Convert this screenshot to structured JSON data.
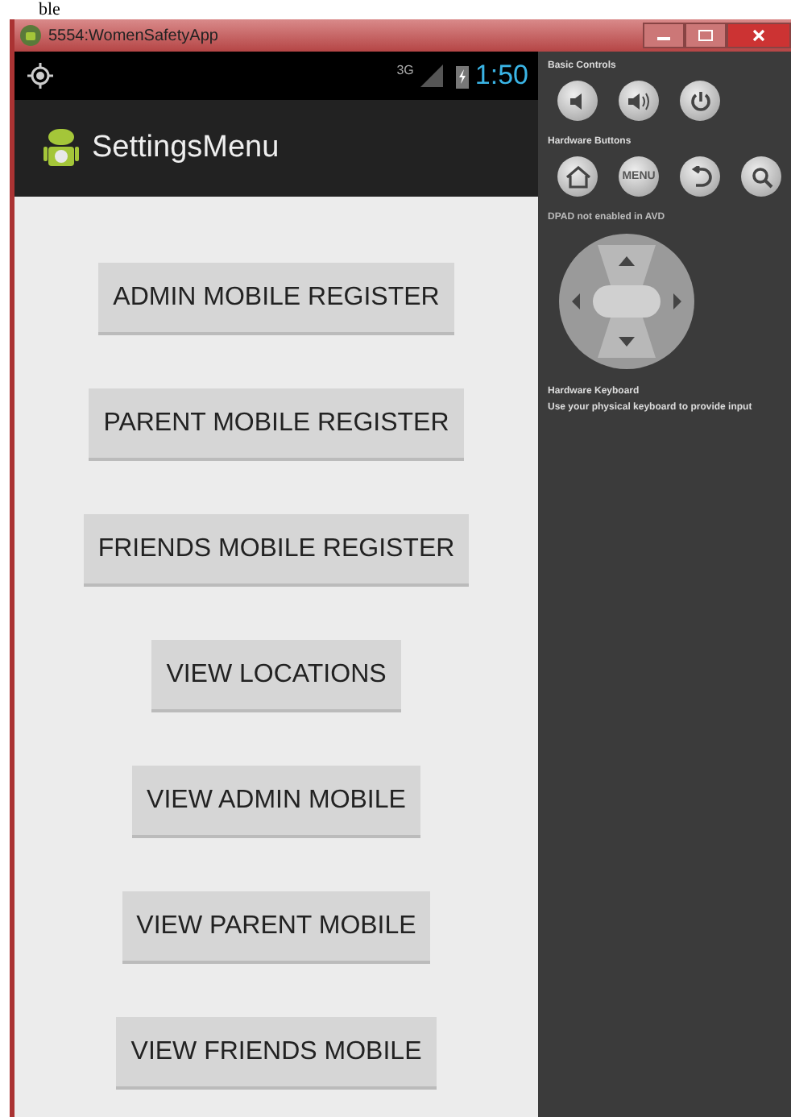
{
  "page_fragment": "ble",
  "window": {
    "title": "5554:WomenSafetyApp"
  },
  "status_bar": {
    "network": "3G",
    "time": "1:50"
  },
  "action_bar": {
    "title": "SettingsMenu"
  },
  "buttons": [
    "ADMIN MOBILE REGISTER",
    "PARENT MOBILE REGISTER",
    "FRIENDS MOBILE REGISTER",
    "VIEW LOCATIONS",
    "VIEW ADMIN MOBILE",
    "VIEW PARENT MOBILE",
    "VIEW FRIENDS MOBILE"
  ],
  "controls": {
    "basic_label": "Basic Controls",
    "hardware_label": "Hardware Buttons",
    "menu_key": "MENU",
    "dpad_label": "DPAD not enabled in AVD",
    "keyboard_title": "Hardware Keyboard",
    "keyboard_text": "Use your physical keyboard to provide input"
  }
}
